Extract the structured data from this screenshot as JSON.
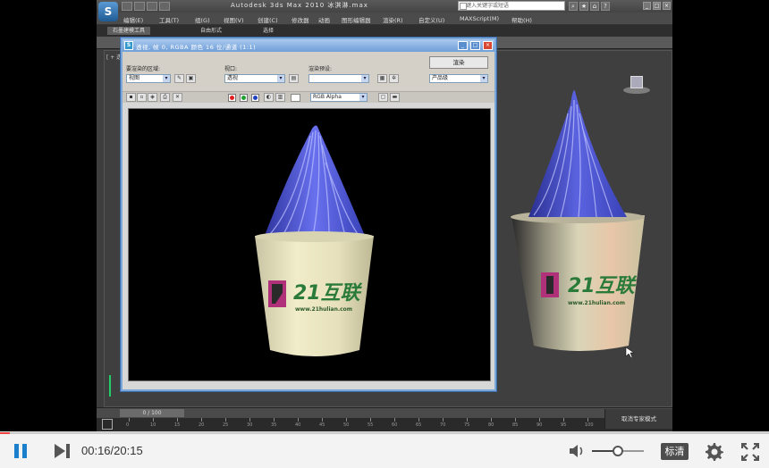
{
  "app": {
    "logo": "S",
    "title": "Autodesk 3ds Max  2010     冰淇淋.max",
    "search_placeholder": "键入关键字或短语",
    "menu": [
      "编辑(E)",
      "工具(T)",
      "组(G)",
      "视图(V)",
      "创建(C)",
      "修改器",
      "动画",
      "图形编辑器",
      "渲染(R)",
      "自定义(U)",
      "MAXScript(M)",
      "帮助(H)"
    ],
    "ribbon_tabs": [
      "石墨建模工具",
      "自由形式",
      "选择"
    ],
    "viewport_label": "[ + 透视 ]",
    "frame_counter": "0 / 100",
    "status_button": "取消专家模式",
    "timeline_ticks": [
      "0",
      "10",
      "15",
      "20",
      "25",
      "30",
      "35",
      "40",
      "45",
      "50",
      "55",
      "60",
      "65",
      "70",
      "75",
      "80",
      "85",
      "90",
      "95",
      "100"
    ]
  },
  "render_window": {
    "title": "透视, 帧 0, RGBA 颜色 16 位/通道 (1:1)",
    "area_label": "要渲染的区域:",
    "area_value": "视图",
    "viewport_label": "视口:",
    "viewport_value": "透视",
    "preset_label": "渲染预设:",
    "preset_value": "",
    "render_button": "渲染",
    "product_value": "产品级",
    "channel_value": "RGB Alpha"
  },
  "scene": {
    "logo_text": "21互联",
    "logo_url": "www.21hulian.com",
    "colors": {
      "cream": "#ece7c4",
      "icecream": "#4a52c8",
      "accent": "#2a7a3a",
      "logo_mark": "#b0307a"
    }
  },
  "player": {
    "time": "00:16/20:15",
    "progress": 0.013,
    "volume": 0.5,
    "quality_label": "标清",
    "accent": "#1b7fcc"
  }
}
